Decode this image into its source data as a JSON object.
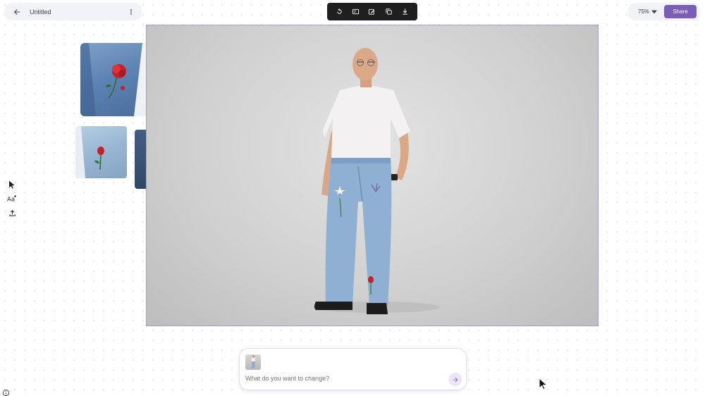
{
  "header": {
    "document_title": "Untitled",
    "icons": {
      "back": "arrow-left-icon",
      "more": "more-vert-icon"
    }
  },
  "toolbar": {
    "tools": [
      "refresh-icon",
      "edit-frame-icon",
      "magic-edit-icon",
      "duplicate-icon",
      "download-icon"
    ]
  },
  "top_right": {
    "zoom_label": "75%",
    "share_label": "Share",
    "accent_color": "#7b5cb8"
  },
  "left_tools": [
    "cursor-icon",
    "text-icon",
    "upload-icon"
  ],
  "prompt": {
    "placeholder": "What do you want to change?",
    "send_icon": "arrow-right-icon"
  },
  "colors": {
    "selection_border": "#a79bd8",
    "toolbar_bg": "#1f1f1f"
  }
}
